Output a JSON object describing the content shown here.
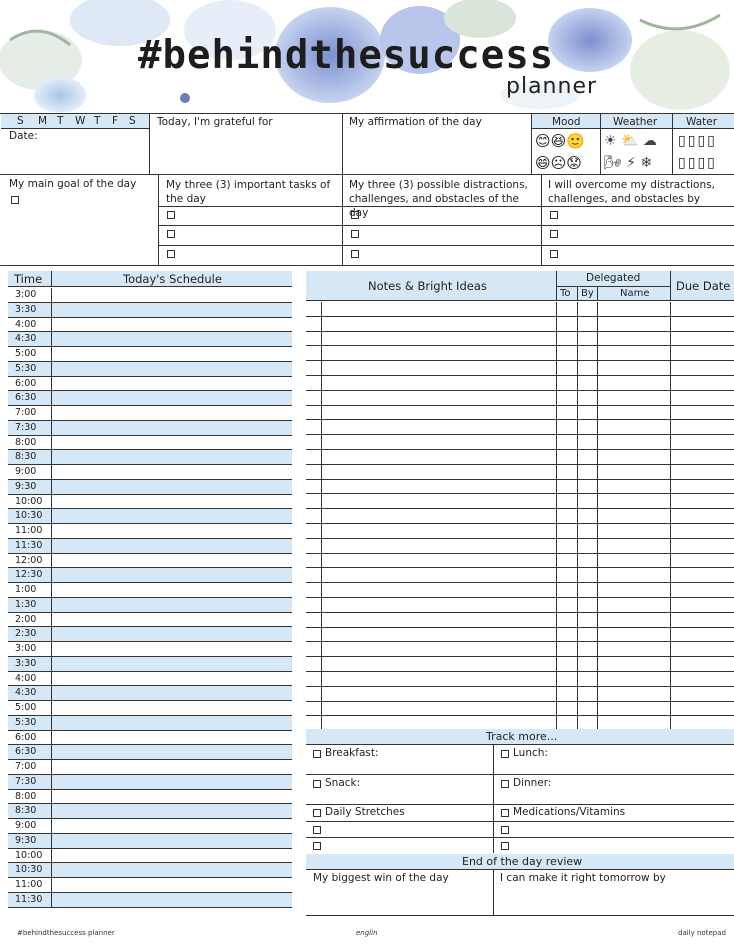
{
  "header": {
    "title": "#behindthesuccess",
    "subtitle": "planner"
  },
  "top_row": {
    "days": [
      "S",
      "M",
      "T",
      "W",
      "T",
      "F",
      "S"
    ],
    "date_label": "Date:",
    "grateful_label": "Today, I'm grateful for",
    "affirmation_label": "My affirmation of the day",
    "mood_label": "Mood",
    "weather_label": "Weather",
    "water_label": "Water",
    "mood_icons": [
      "😊",
      "😆",
      "🙂",
      "😄",
      "☹",
      "😟"
    ],
    "weather_icons": [
      "☀",
      "⛅",
      "☁",
      "🌬",
      "⚡",
      "❄"
    ],
    "water_icons": [
      "▯",
      "▯",
      "▯",
      "▯",
      "▯",
      "▯",
      "▯",
      "▯"
    ]
  },
  "goals": {
    "main_goal_label": "My main goal of the day",
    "important_tasks_label": "My three (3) important tasks of the day",
    "distractions_label": "My three (3) possible distractions, challenges, and obstacles of the day",
    "overcome_label": "I will overcome my distractions, challenges, and obstacles by"
  },
  "schedule": {
    "time_header": "Time",
    "schedule_header": "Today's Schedule",
    "times": [
      "3:00",
      "3:30",
      "4:00",
      "4:30",
      "5:00",
      "5:30",
      "6:00",
      "6:30",
      "7:00",
      "7:30",
      "8:00",
      "8:30",
      "9:00",
      "9:30",
      "10:00",
      "10:30",
      "11:00",
      "11:30",
      "12:00",
      "12:30",
      "1:00",
      "1:30",
      "2:00",
      "2:30",
      "3:00",
      "3:30",
      "4:00",
      "4:30",
      "5:00",
      "5:30",
      "6:00",
      "6:30",
      "7:00",
      "7:30",
      "8:00",
      "8:30",
      "9:00",
      "9:30",
      "10:00",
      "10:30",
      "11:00",
      "11:30"
    ]
  },
  "notes": {
    "notes_header": "Notes & Bright Ideas",
    "delegated_header": "Delegated",
    "to_header": "To",
    "by_header": "By",
    "name_header": "Name",
    "due_header": "Due Date"
  },
  "track": {
    "header": "Track more...",
    "breakfast": "Breakfast:",
    "lunch": "Lunch:",
    "snack": "Snack:",
    "dinner": "Dinner:",
    "stretches": "Daily Stretches",
    "meds": "Medications/Vitamins"
  },
  "review": {
    "header": "End of the day review",
    "biggest_win": "My biggest win of the day",
    "make_right": "I can make it right tomorrow by"
  },
  "footer": {
    "left": "#behindthesuccess planner",
    "center": "englin",
    "right": "daily notepad"
  },
  "colors": {
    "accent_blue": "#d6e8f6",
    "line": "#333333",
    "floral_blue": "#8ea6d8"
  }
}
